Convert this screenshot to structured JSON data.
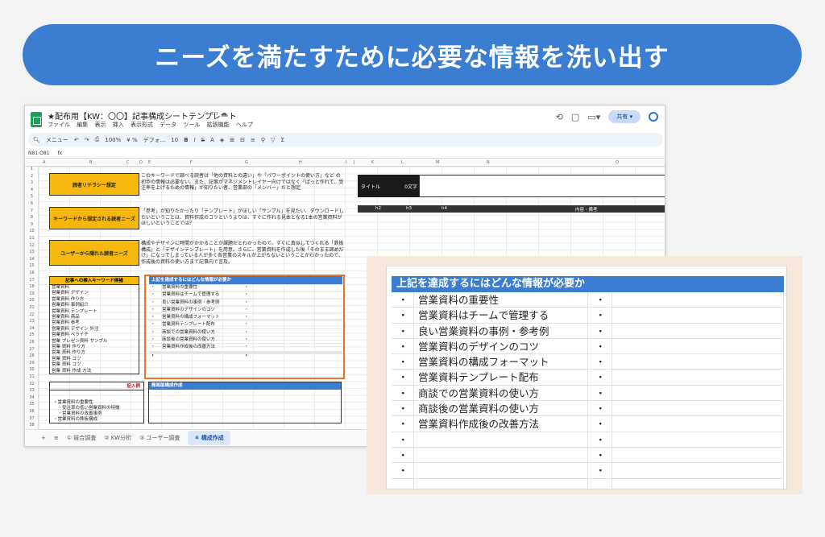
{
  "banner": {
    "title": "ニーズを満たすために必要な情報を洗い出す"
  },
  "window": {
    "doc_title": "★配布用【KW：〇〇】記事構成シートテンプレート",
    "menu": [
      "ファイル",
      "編集",
      "表示",
      "挿入",
      "表示形式",
      "データ",
      "ツール",
      "拡張機能",
      "ヘルプ"
    ],
    "share_label": "共有",
    "toolbar": {
      "menu_search": "メニュー",
      "zoom": "100%",
      "font": "デフォ...",
      "font_size": "10"
    },
    "cell_ref": "N81:O81",
    "fx": "fx"
  },
  "columns": [
    "A",
    "B",
    "C",
    "D",
    "E",
    "F",
    "G",
    "H",
    "I",
    "J",
    "K",
    "L",
    "M",
    "N",
    "O"
  ],
  "left_section": {
    "literacy_label": "読者リテラシー想定",
    "literacy_text": "このキーワードで調べる読者は「他の資料との違い」や「パワーポイントの使い方」など の初歩の情報は必要ない。また、記事がマネジメントレイヤー向けではなく「ぱっと作れて、受注率を上げるための情報」が知りたい者、営業部の「メンバー」だと想定",
    "needs_label": "キーワードから想定される読者ニーズ",
    "needs_text": "「参考」が知りたかったり「テンプレート」がほしい「サンプル」を見たい、ダウンロードしたいということは、資料作成のコツというよりは、すぐに作れる見本となる1本の営業資料がほしいということでは？",
    "hidden_label": "ユーザーから隠れた読者ニーズ",
    "hidden_text": "構成やデザインに時間がかかることが課題だとわかったので、すぐに真似してつくれる「鉄板構成」と「デザインテンプレート」を用意。さらに、営業資料を作成した後「そのまま諦めだけ」になってしまっている人が多く各営業のスキルが上がらないということがわかったので、作成後の資料の使い方まで記事内で言及。",
    "kw_head": "記事への挿入キーワード候補",
    "keywords": [
      "営業資料",
      "営業資料 デザイン",
      "営業資料 作り方",
      "営業資料 事例紹介",
      "営業資料 テンプレート",
      "営業資料 商品",
      "営業資料 参考",
      "営業資料 デザイン 外注",
      "営業資料 ペライチ",
      "営業 プレゼン資料 サンプル",
      "営業 資料 作り方",
      "営業 資料 作り方",
      "営業 資料 コツ",
      "営業 資料 コツ",
      "営業 資料 作成 方法"
    ],
    "memo_head": "記入例",
    "memo_items": [
      "・営業資料の重要性",
      "　・受注率の低い営業資料の特徴",
      "　・営業資料の改善事例",
      "・営業資料の鉄板構成"
    ],
    "simple_head": "簡易版構成作成"
  },
  "mini_block": {
    "head": "上記を達成するにはどんな情報が必要か",
    "items": [
      "営業資料の重要性",
      "営業資料はチームで管理する",
      "良い営業資料の事例・参考例",
      "営業資料のデザインのコツ",
      "営業資料の構成フォーマット",
      "営業資料テンプレート配布",
      "商談での営業資料の使い方",
      "商談後の営業資料の使い方",
      "営業資料作成後の改善方法",
      "",
      "",
      ""
    ]
  },
  "right_section": {
    "title_label": "タイトル",
    "char_count": "0文字",
    "headers": [
      "h2",
      "h3",
      "h4",
      "内容・備考"
    ]
  },
  "tabs": [
    "① 競合調査",
    "② KW分析",
    "③ ユーザー調査",
    "④ 構成作成"
  ],
  "zoom": {
    "head": "上記を達成するにはどんな情報が必要か",
    "bullet": "・",
    "items": [
      "営業資料の重要性",
      "営業資料はチームで管理する",
      "良い営業資料の事例・参考例",
      "営業資料のデザインのコツ",
      "営業資料の構成フォーマット",
      "営業資料テンプレート配布",
      "商談での営業資料の使い方",
      "商談後の営業資料の使い方",
      "営業資料作成後の改善方法",
      "",
      "",
      ""
    ]
  }
}
